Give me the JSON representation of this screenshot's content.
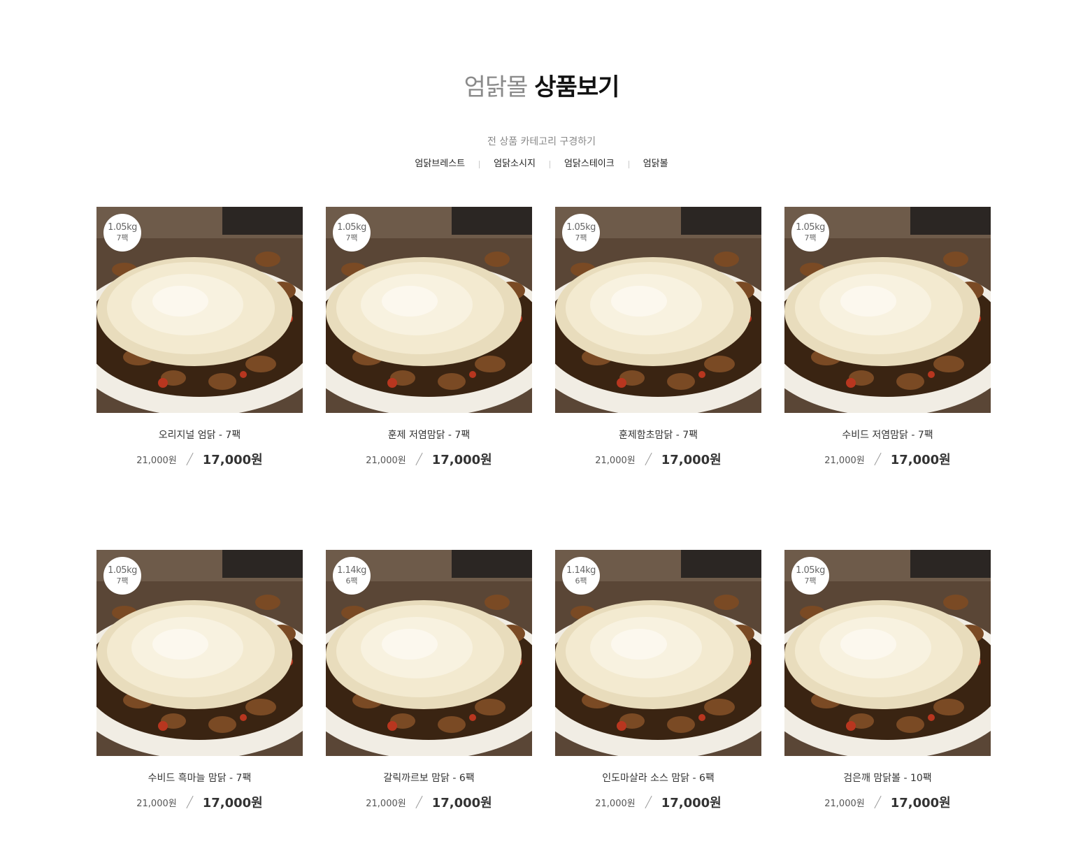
{
  "header": {
    "brand": "엄닭몰",
    "title": "상품보기",
    "subtitle": "전 상품 카테고리 구경하기"
  },
  "categories": [
    {
      "label": "엄닭브레스트"
    },
    {
      "label": "엄닭소시지"
    },
    {
      "label": "엄닭스테이크"
    },
    {
      "label": "엄닭볼"
    }
  ],
  "products": [
    {
      "name": "오리지널 엄닭 - 7팩",
      "weight": "1.05kg",
      "packs": "7팩",
      "old_price": "21,000원",
      "price": "17,000원"
    },
    {
      "name": "훈제 저염맘닭 - 7팩",
      "weight": "1.05kg",
      "packs": "7팩",
      "old_price": "21,000원",
      "price": "17,000원"
    },
    {
      "name": "훈제함초맘닭 - 7팩",
      "weight": "1.05kg",
      "packs": "7팩",
      "old_price": "21,000원",
      "price": "17,000원"
    },
    {
      "name": "수비드 저염맘닭 - 7팩",
      "weight": "1.05kg",
      "packs": "7팩",
      "old_price": "21,000원",
      "price": "17,000원"
    },
    {
      "name": "수비드 흑마늘 맘닭 - 7팩",
      "weight": "1.05kg",
      "packs": "7팩",
      "old_price": "21,000원",
      "price": "17,000원"
    },
    {
      "name": "갈릭까르보 맘닭 - 6팩",
      "weight": "1.14kg",
      "packs": "6팩",
      "old_price": "21,000원",
      "price": "17,000원"
    },
    {
      "name": "인도마살라 소스 맘닭 - 6팩",
      "weight": "1.14kg",
      "packs": "6팩",
      "old_price": "21,000원",
      "price": "17,000원"
    },
    {
      "name": "검은깨 맘닭볼 - 10팩",
      "weight": "1.05kg",
      "packs": "7팩",
      "old_price": "21,000원",
      "price": "17,000원"
    }
  ],
  "colors": {
    "brand_gray": "#8a8a8a",
    "title_dark": "#111111",
    "sauce": "#3a2412",
    "plate": "#f1ede4",
    "cheese": "#f3ead0"
  }
}
